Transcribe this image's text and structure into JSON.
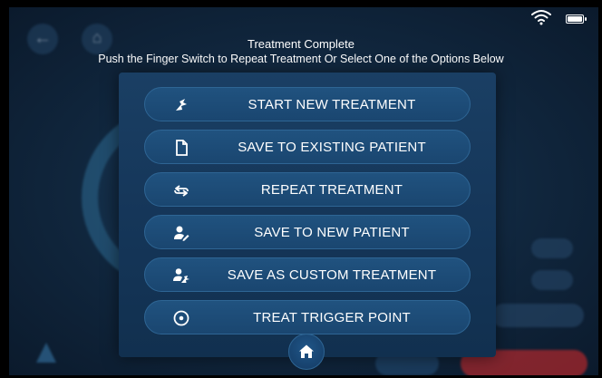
{
  "dialog": {
    "title": "Treatment Complete",
    "subtitle": "Push the Finger Switch to Repeat Treatment Or Select One of the Options Below",
    "options": [
      {
        "label": "START NEW TREATMENT",
        "icon": "handpiece-icon"
      },
      {
        "label": "SAVE TO EXISTING PATIENT",
        "icon": "document-icon"
      },
      {
        "label": "REPEAT TREATMENT",
        "icon": "repeat-icon"
      },
      {
        "label": "SAVE TO NEW PATIENT",
        "icon": "add-patient-icon"
      },
      {
        "label": "SAVE AS CUSTOM TREATMENT",
        "icon": "custom-treatment-icon"
      },
      {
        "label": "TREAT TRIGGER POINT",
        "icon": "target-icon"
      }
    ],
    "home_icon": "home-icon"
  },
  "status_bar": {
    "wifi_icon": "wifi-icon",
    "battery_icon": "battery-icon"
  },
  "colors": {
    "panel": "#153659",
    "button": "#1d4b76",
    "alert_red": "#e02a2a"
  }
}
